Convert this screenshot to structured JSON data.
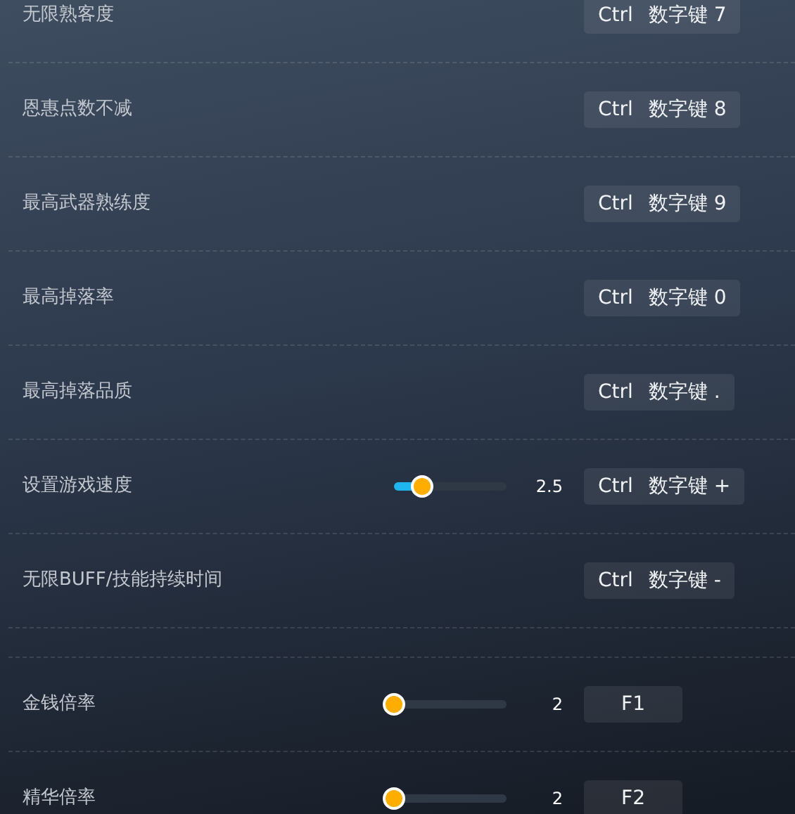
{
  "sections": [
    {
      "rows": [
        {
          "kind": "hotkey",
          "label": "无限熟客度",
          "keys": [
            "Ctrl",
            "数字键 7"
          ]
        },
        {
          "kind": "hotkey",
          "label": "恩惠点数不减",
          "keys": [
            "Ctrl",
            "数字键 8"
          ]
        },
        {
          "kind": "hotkey",
          "label": "最高武器熟练度",
          "keys": [
            "Ctrl",
            "数字键 9"
          ]
        },
        {
          "kind": "hotkey",
          "label": "最高掉落率",
          "keys": [
            "Ctrl",
            "数字键 0"
          ]
        },
        {
          "kind": "hotkey",
          "label": "最高掉落品质",
          "keys": [
            "Ctrl",
            "数字键 ."
          ]
        },
        {
          "kind": "slider",
          "label": "设置游戏速度",
          "level": 0.25,
          "reading": "2.5",
          "keys": [
            "Ctrl",
            "数字键 +"
          ]
        },
        {
          "kind": "hotkey",
          "label": "无限BUFF/技能持续时间",
          "keys": [
            "Ctrl",
            "数字键 -"
          ]
        }
      ]
    },
    {
      "rows": [
        {
          "kind": "slider",
          "label": "金钱倍率",
          "level": 0,
          "reading": "2",
          "keys": [
            "F1"
          ]
        },
        {
          "kind": "slider",
          "label": "精华倍率",
          "level": 0,
          "reading": "2",
          "keys": [
            "F2"
          ]
        }
      ]
    }
  ]
}
